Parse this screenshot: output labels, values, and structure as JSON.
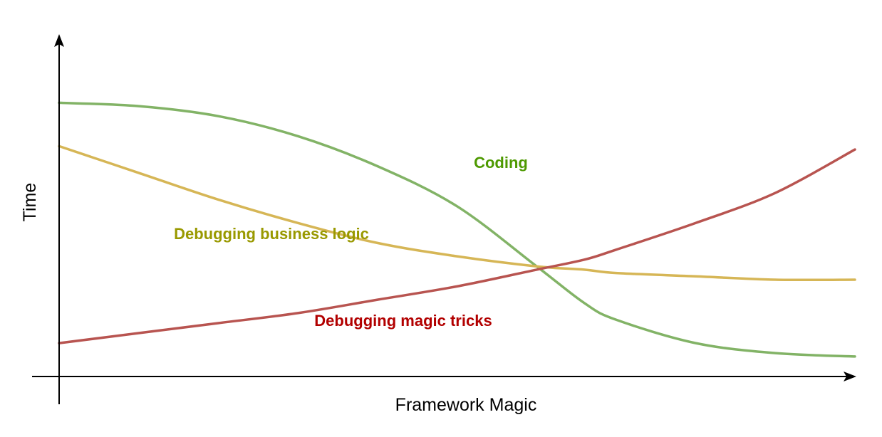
{
  "chart_data": {
    "type": "line",
    "xlabel": "Framework Magic",
    "ylabel": "Time",
    "xlim": [
      0,
      1
    ],
    "ylim": [
      0,
      1
    ],
    "grid": false,
    "legend": "none",
    "series": [
      {
        "name": "Coding",
        "color": "#82b366",
        "label_color": "#4d9900",
        "x": [
          0,
          0.1,
          0.2,
          0.3,
          0.4,
          0.5,
          0.6,
          0.66,
          0.7,
          0.8,
          0.9,
          1.0
        ],
        "y": [
          0.82,
          0.81,
          0.78,
          0.72,
          0.63,
          0.51,
          0.33,
          0.22,
          0.17,
          0.1,
          0.07,
          0.06
        ]
      },
      {
        "name": "Debugging business logic",
        "color": "#d6b656",
        "label_color": "#999900",
        "x": [
          0,
          0.1,
          0.2,
          0.3,
          0.4,
          0.5,
          0.6,
          0.66,
          0.7,
          0.8,
          0.9,
          1.0
        ],
        "y": [
          0.69,
          0.61,
          0.53,
          0.46,
          0.4,
          0.36,
          0.33,
          0.32,
          0.31,
          0.3,
          0.29,
          0.29
        ]
      },
      {
        "name": "Debugging magic tricks",
        "color": "#b85450",
        "label_color": "#b20000",
        "x": [
          0,
          0.1,
          0.2,
          0.3,
          0.4,
          0.5,
          0.6,
          0.66,
          0.7,
          0.8,
          0.9,
          1.0
        ],
        "y": [
          0.1,
          0.13,
          0.16,
          0.19,
          0.23,
          0.27,
          0.32,
          0.35,
          0.38,
          0.46,
          0.55,
          0.68
        ]
      }
    ]
  }
}
